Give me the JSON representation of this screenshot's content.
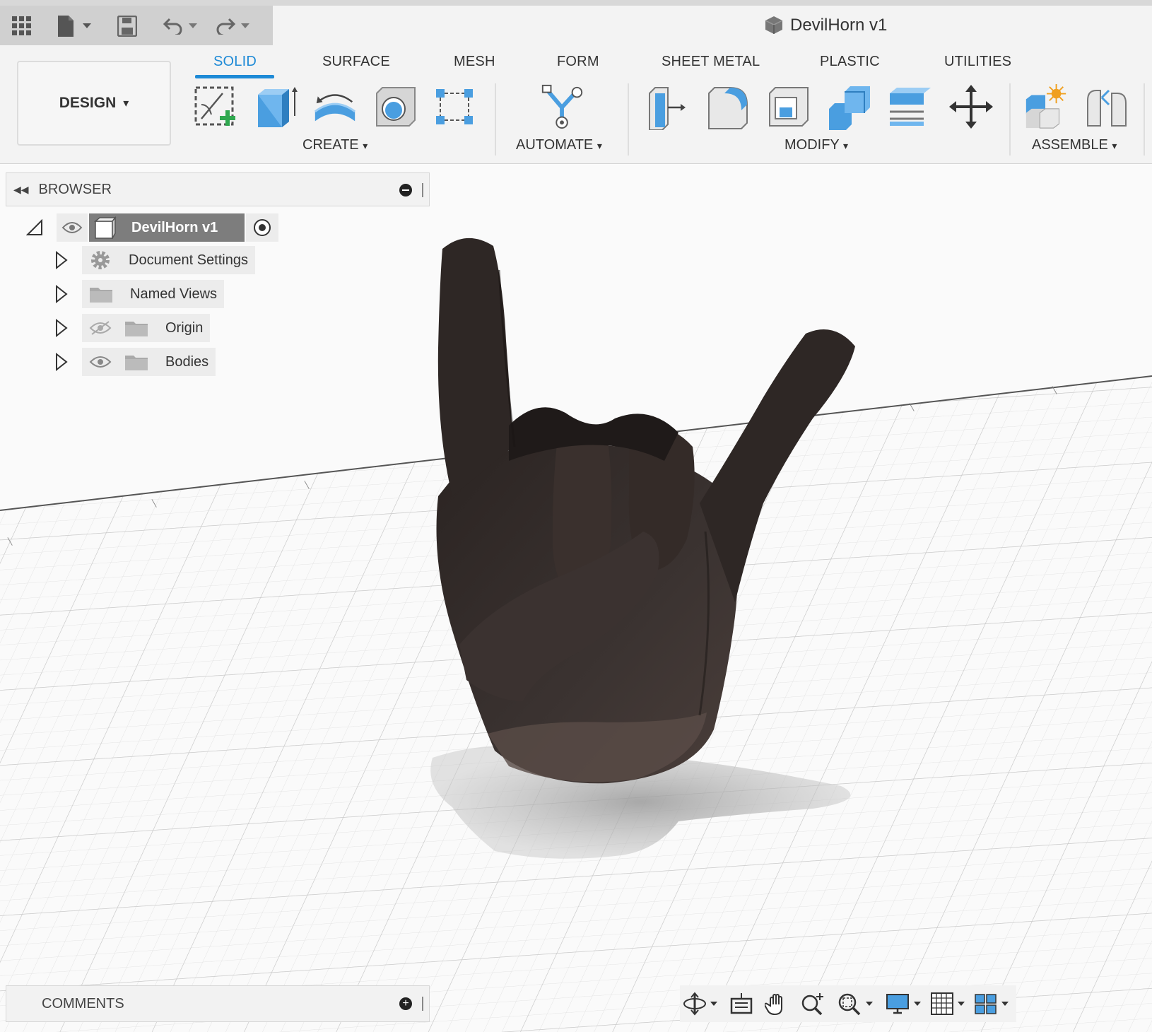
{
  "document": {
    "title": "DevilHorn v1"
  },
  "workspace": {
    "label": "DESIGN"
  },
  "tabs": [
    {
      "label": "SOLID",
      "active": true
    },
    {
      "label": "SURFACE"
    },
    {
      "label": "MESH"
    },
    {
      "label": "FORM"
    },
    {
      "label": "SHEET METAL"
    },
    {
      "label": "PLASTIC"
    },
    {
      "label": "UTILITIES"
    }
  ],
  "groups": {
    "create": "CREATE",
    "automate": "AUTOMATE",
    "modify": "MODIFY",
    "assemble": "ASSEMBLE"
  },
  "dropdown_caret": "▾",
  "browser": {
    "title": "BROWSER",
    "root": "DevilHorn v1",
    "items": [
      {
        "label": "Document Settings"
      },
      {
        "label": "Named Views"
      },
      {
        "label": "Origin"
      },
      {
        "label": "Bodies"
      }
    ]
  },
  "comments": {
    "title": "COMMENTS"
  },
  "colors": {
    "accent": "#1e8ad6",
    "tool_blue": "#4a9ee0",
    "mesh": "#3b3331",
    "add_green": "#2fa84f"
  },
  "icons": [
    "apps-grid-icon",
    "file-icon",
    "save-icon",
    "undo-icon",
    "redo-icon",
    "new-sketch-icon",
    "extrude-icon",
    "revolve-icon",
    "hole-icon",
    "pattern-icon",
    "automate-icon",
    "press-pull-icon",
    "fillet-icon",
    "shell-icon",
    "combine-icon",
    "offset-face-icon",
    "move-icon",
    "new-component-icon",
    "joint-icon",
    "eye-icon",
    "eye-hidden-icon",
    "gear-icon",
    "folder-icon",
    "orbit-icon",
    "look-at-icon",
    "pan-icon",
    "zoom-icon",
    "fit-icon",
    "display-settings-icon",
    "grid-icon",
    "viewports-icon"
  ]
}
